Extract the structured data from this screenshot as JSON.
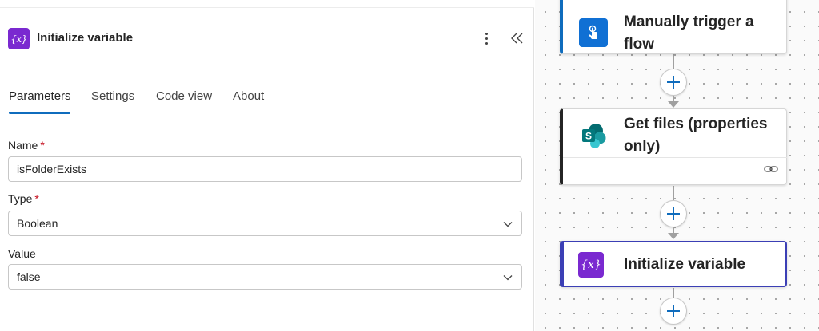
{
  "panel": {
    "title": "Initialize variable",
    "icon": "variable-icon",
    "tabs": [
      {
        "label": "Parameters",
        "active": true
      },
      {
        "label": "Settings"
      },
      {
        "label": "Code view"
      },
      {
        "label": "About"
      }
    ],
    "fields": {
      "name": {
        "label": "Name",
        "required_mark": "*",
        "value": "isFolderExists"
      },
      "type": {
        "label": "Type",
        "required_mark": "*",
        "value": "Boolean"
      },
      "value": {
        "label": "Value",
        "value": "false"
      }
    }
  },
  "flow": {
    "cards": [
      {
        "title": "Manually trigger a flow",
        "icon": "touch-trigger-icon"
      },
      {
        "title": "Get files (properties only)",
        "icon": "sharepoint-icon"
      },
      {
        "title": "Initialize variable",
        "icon": "variable-icon"
      }
    ],
    "icon_text": "{x}"
  },
  "colors": {
    "accent": "#0f6cbd",
    "variable_purple": "#7a29d0",
    "selected_border": "#3b3fb5",
    "required": "#c50f1f"
  }
}
